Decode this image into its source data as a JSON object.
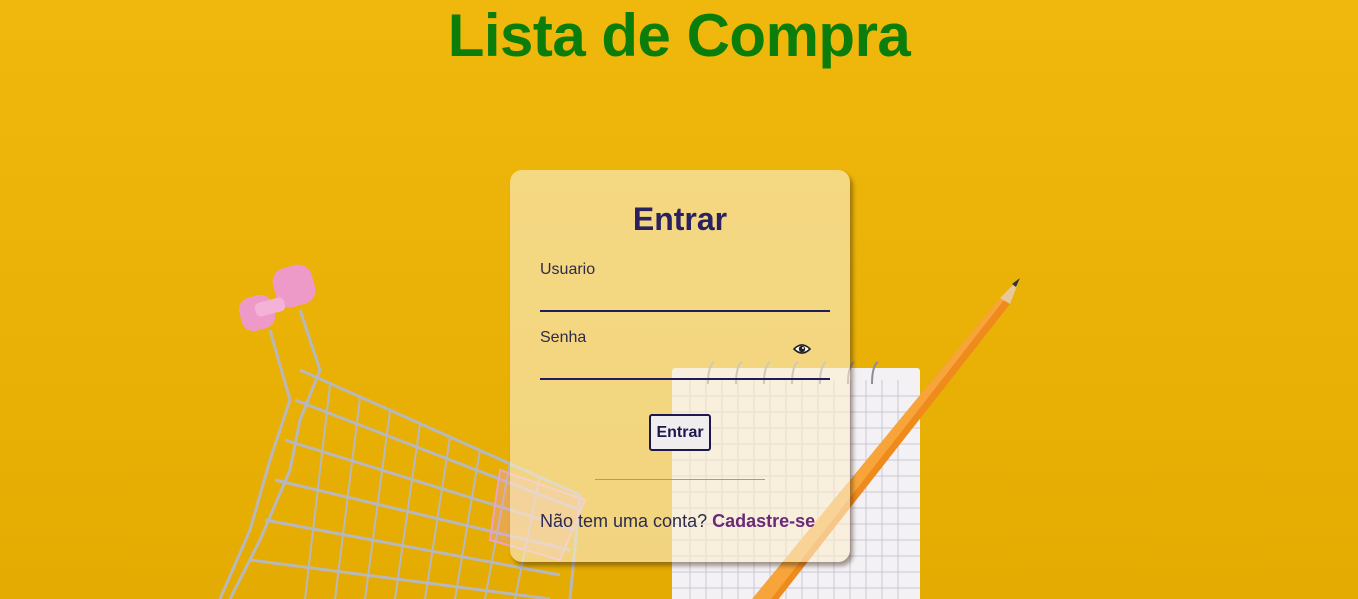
{
  "app": {
    "title": "Lista de Compra"
  },
  "login": {
    "title": "Entrar",
    "username_label": "Usuario",
    "username_value": "",
    "password_label": "Senha",
    "password_value": "",
    "show_password_icon": "eye-icon",
    "submit_label": "Entrar",
    "no_account_text": "Não tem uma conta?",
    "signup_link": "Cadastre-se"
  },
  "colors": {
    "background": "#e9b105",
    "title": "#0a7d0a",
    "heading": "#2a2160",
    "link": "#6b2a78"
  }
}
